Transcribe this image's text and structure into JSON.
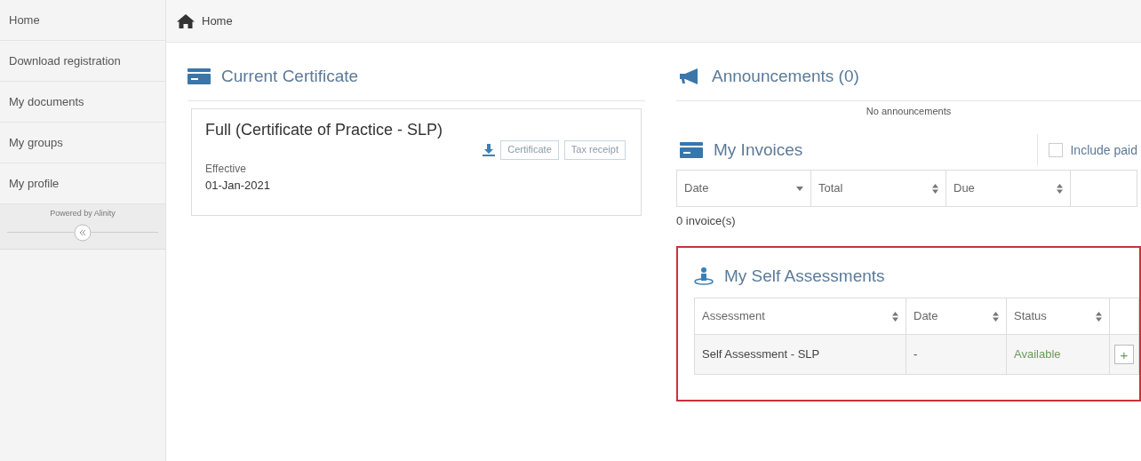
{
  "sidebar": {
    "items": [
      {
        "label": "Home"
      },
      {
        "label": "Download registration"
      },
      {
        "label": "My documents"
      },
      {
        "label": "My groups"
      },
      {
        "label": "My profile"
      }
    ],
    "footer": "Powered by Alinity"
  },
  "breadcrumb": {
    "label": "Home"
  },
  "current_certificate": {
    "title": "Current Certificate",
    "name": "Full (Certificate of Practice - SLP)",
    "buttons": [
      "Certificate",
      "Tax receipt"
    ],
    "field_label": "Effective",
    "field_value": "01-Jan-2021"
  },
  "announcements": {
    "title": "Announcements (0)",
    "empty_text": "No announcements"
  },
  "invoices": {
    "title": "My Invoices",
    "include_paid": {
      "label": "Include paid",
      "checked": false
    },
    "columns": [
      {
        "label": "Date",
        "kind": "sorted"
      },
      {
        "label": "Total",
        "kind": "sortable"
      },
      {
        "label": "Due",
        "kind": "sortable"
      }
    ],
    "count": "0 invoice(s)"
  },
  "self_assessments": {
    "title": "My Self Assessments",
    "highlighted": true,
    "columns": [
      {
        "label": "Assessment",
        "kind": "sortable"
      },
      {
        "label": "Date",
        "kind": "sortable"
      },
      {
        "label": "Status",
        "kind": "sortable"
      }
    ],
    "rows": [
      {
        "assessment": "Self Assessment - SLP",
        "date": "-",
        "status": "Available",
        "action": "+"
      }
    ]
  }
}
